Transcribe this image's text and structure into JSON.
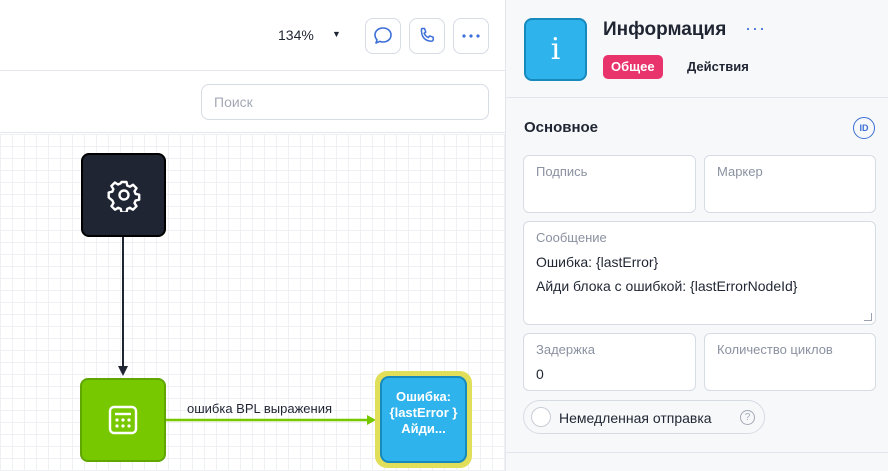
{
  "toolbar": {
    "zoom_value": "134%",
    "chat_icon": "chat-bubble-icon",
    "call_icon": "phone-icon",
    "more_icon": "more-dots-icon"
  },
  "search": {
    "placeholder": "Поиск"
  },
  "canvas": {
    "nodes": {
      "start": {
        "icon": "gear-icon"
      },
      "expression": {
        "icon": "calculator-icon"
      },
      "info": {
        "text": "Ошибка: {lastError } Айди..."
      }
    },
    "edge_label": "ошибка BPL выражения"
  },
  "panel": {
    "icon": "info-icon",
    "icon_glyph": "i",
    "title": "Информация",
    "tabs": {
      "general": "Общее",
      "actions": "Действия"
    },
    "section_title": "Основное",
    "id_badge": "ID",
    "fields": {
      "signature": {
        "label": "Подпись",
        "value": ""
      },
      "marker": {
        "label": "Маркер",
        "value": ""
      },
      "message": {
        "label": "Сообщение",
        "value": "Ошибка: {lastError}\nАйди блока с ошибкой: {lastErrorNodeId}"
      },
      "delay": {
        "label": "Задержка",
        "value": "0"
      },
      "loop_count": {
        "label": "Количество циклов",
        "value": ""
      }
    },
    "immediate_send": {
      "label": "Немедленная отправка",
      "help": "?"
    }
  },
  "colors": {
    "accent_blue": "#3c6fd8",
    "tab_active": "#e8336d",
    "node_dark": "#1f2532",
    "node_green": "#78c800",
    "node_info": "#2fb3ec",
    "node_highlight": "#e1de5a"
  }
}
